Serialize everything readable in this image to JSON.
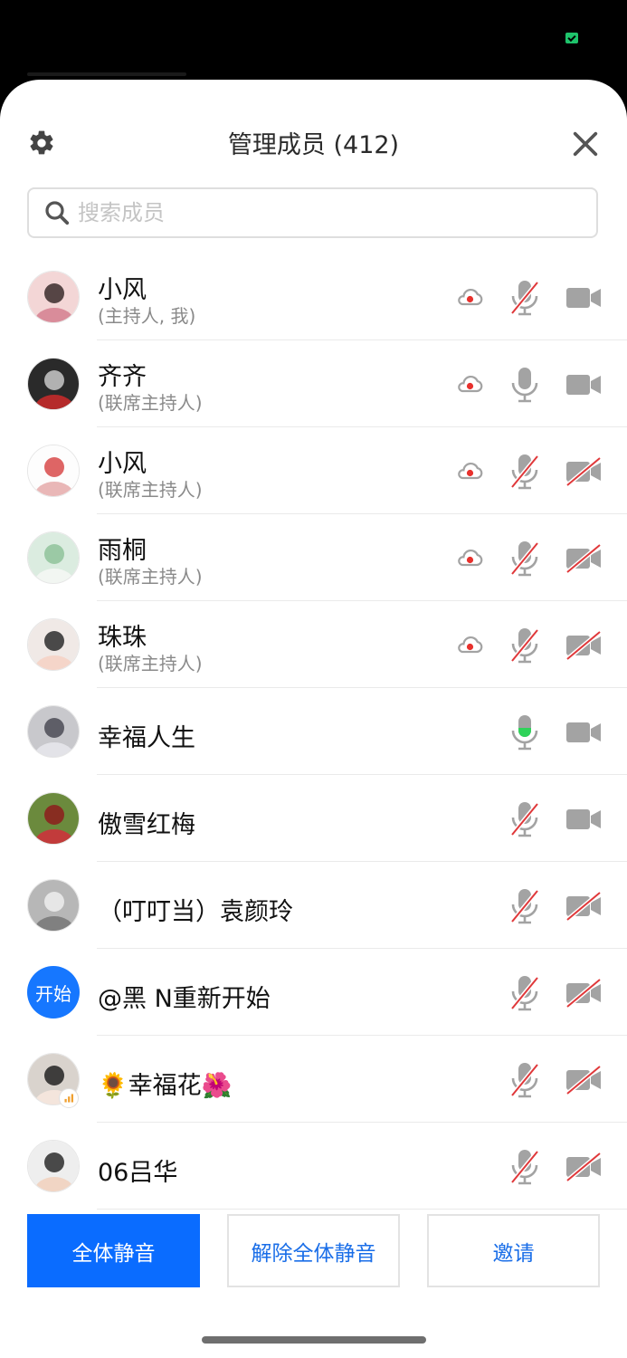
{
  "header": {
    "title": "管理成员 (412)",
    "settings_icon": "gear-icon",
    "close_icon": "close-icon"
  },
  "search": {
    "placeholder": "搜索成员",
    "value": ""
  },
  "members": [
    {
      "name": "小风",
      "role": "(主持人, 我)",
      "avatar": "photo",
      "cloud_recording": true,
      "mic": "muted",
      "camera": "on"
    },
    {
      "name": "齐齐",
      "role": "(联席主持人)",
      "avatar": "photo",
      "cloud_recording": true,
      "mic": "on",
      "camera": "on"
    },
    {
      "name": "小风",
      "role": "(联席主持人)",
      "avatar": "photo",
      "cloud_recording": true,
      "mic": "muted",
      "camera": "off"
    },
    {
      "name": "雨桐",
      "role": "(联席主持人)",
      "avatar": "photo",
      "cloud_recording": true,
      "mic": "muted",
      "camera": "off"
    },
    {
      "name": "珠珠",
      "role": "(联席主持人)",
      "avatar": "photo",
      "cloud_recording": true,
      "mic": "muted",
      "camera": "off"
    },
    {
      "name": "幸福人生",
      "role": "",
      "avatar": "photo",
      "cloud_recording": false,
      "mic": "speaking",
      "camera": "on"
    },
    {
      "name": "傲雪红梅",
      "role": "",
      "avatar": "photo",
      "cloud_recording": false,
      "mic": "muted",
      "camera": "on"
    },
    {
      "name": "（叮叮当）袁颜玲",
      "role": "",
      "avatar": "photo",
      "cloud_recording": false,
      "mic": "muted",
      "camera": "off"
    },
    {
      "name": "@黑 N重新开始",
      "role": "",
      "avatar": "text",
      "avatar_text": "开始",
      "cloud_recording": false,
      "mic": "muted",
      "camera": "off"
    },
    {
      "name": "🌻幸福花🌺",
      "role": "",
      "avatar": "photo",
      "cloud_recording": false,
      "mic": "muted",
      "camera": "off",
      "signal_badge": true
    },
    {
      "name": "06吕华",
      "role": "",
      "avatar": "photo",
      "cloud_recording": false,
      "mic": "muted",
      "camera": "off"
    }
  ],
  "footer": {
    "mute_all": "全体静音",
    "unmute_all": "解除全体静音",
    "invite": "邀请"
  },
  "colors": {
    "primary": "#0a6cff",
    "link": "#1a6ee8",
    "record_red": "#e8312d",
    "speaking_green": "#2fd35a",
    "muted_slash": "#e0383a",
    "icon_gray": "#a3a3a3"
  }
}
